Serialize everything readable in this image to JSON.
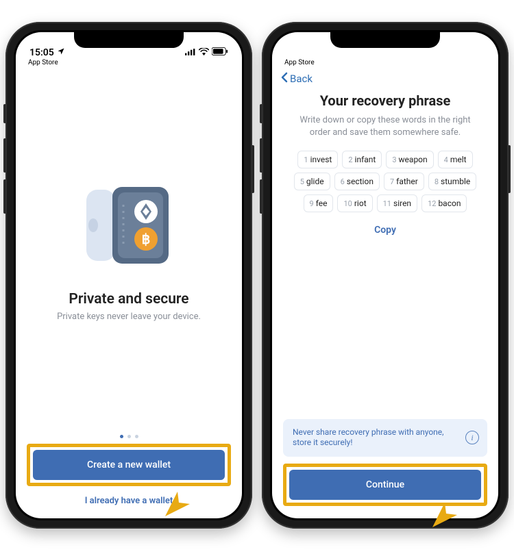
{
  "status": {
    "time": "15:05",
    "app_source": "App Store"
  },
  "screen1": {
    "title": "Private and secure",
    "subtitle": "Private keys never leave your device.",
    "primary_button": "Create a new wallet",
    "secondary_link": "I already have a wallet",
    "pager_active_index": 0,
    "pager_count": 3
  },
  "screen2": {
    "back_label": "Back",
    "title": "Your recovery phrase",
    "subtitle": "Write down or copy these words in the right order and save them somewhere safe.",
    "words": [
      {
        "n": 1,
        "w": "invest"
      },
      {
        "n": 2,
        "w": "infant"
      },
      {
        "n": 3,
        "w": "weapon"
      },
      {
        "n": 4,
        "w": "melt"
      },
      {
        "n": 5,
        "w": "glide"
      },
      {
        "n": 6,
        "w": "section"
      },
      {
        "n": 7,
        "w": "father"
      },
      {
        "n": 8,
        "w": "stumble"
      },
      {
        "n": 9,
        "w": "fee"
      },
      {
        "n": 10,
        "w": "riot"
      },
      {
        "n": 11,
        "w": "siren"
      },
      {
        "n": 12,
        "w": "bacon"
      }
    ],
    "copy_label": "Copy",
    "warning_text": "Never share recovery phrase with anyone, store it securely!",
    "continue_button": "Continue"
  },
  "colors": {
    "accent": "#3f6db3",
    "highlight": "#e8aa13"
  }
}
